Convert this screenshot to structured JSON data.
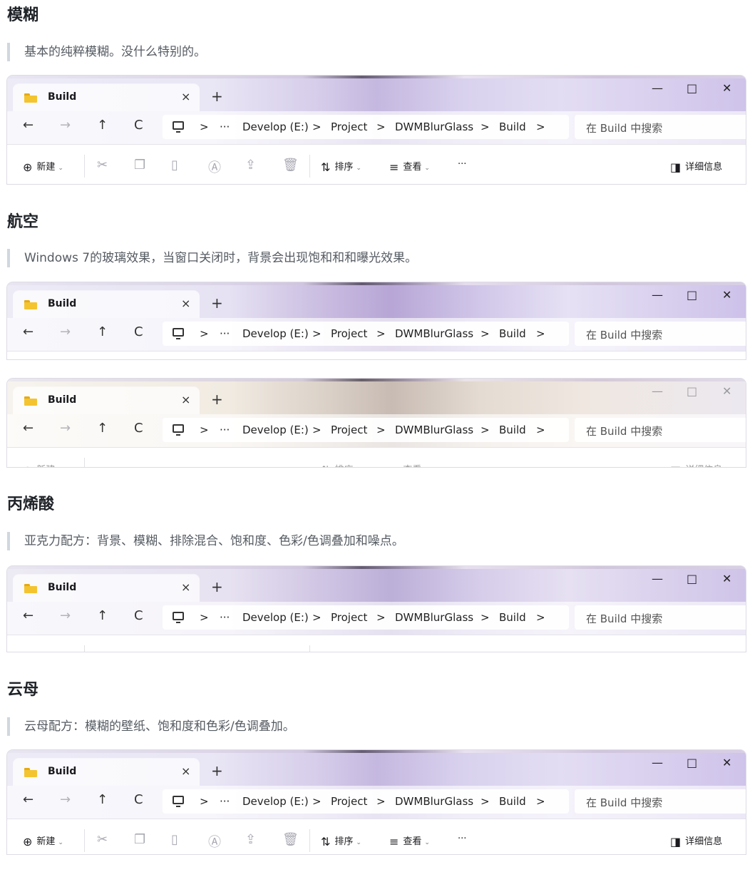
{
  "sections": [
    {
      "title": "模糊",
      "desc": "基本的纯粹模糊。没什么特别的。"
    },
    {
      "title": "航空",
      "desc": "Windows 7的玻璃效果，当窗口关闭时，背景会出现饱和和和曝光效果。"
    },
    {
      "title": "丙烯酸",
      "desc": "亚克力配方：背景、模糊、排除混合、饱和度、色彩/色调叠加和噪点。"
    },
    {
      "title": "云母",
      "desc": "云母配方：模糊的壁纸、饱和度和色彩/色调叠加。"
    }
  ],
  "explorer": {
    "tab_title": "Build",
    "tab_close": "×",
    "new_tab": "+",
    "minimize": "—",
    "maximize": "□",
    "close": "✕",
    "back": "←",
    "forward": "→",
    "up": "↑",
    "refresh": "C",
    "breadcrumb": [
      "Develop (E:)",
      "Project",
      "DWMBlurGlass",
      "Build"
    ],
    "sep": ">",
    "ellipsis": "···",
    "search_placeholder": "在 Build 中搜索",
    "cmd_new": "新建",
    "cmd_sort": "排序",
    "cmd_view": "查看",
    "cmd_more": "···",
    "cmd_details": "详细信息"
  }
}
